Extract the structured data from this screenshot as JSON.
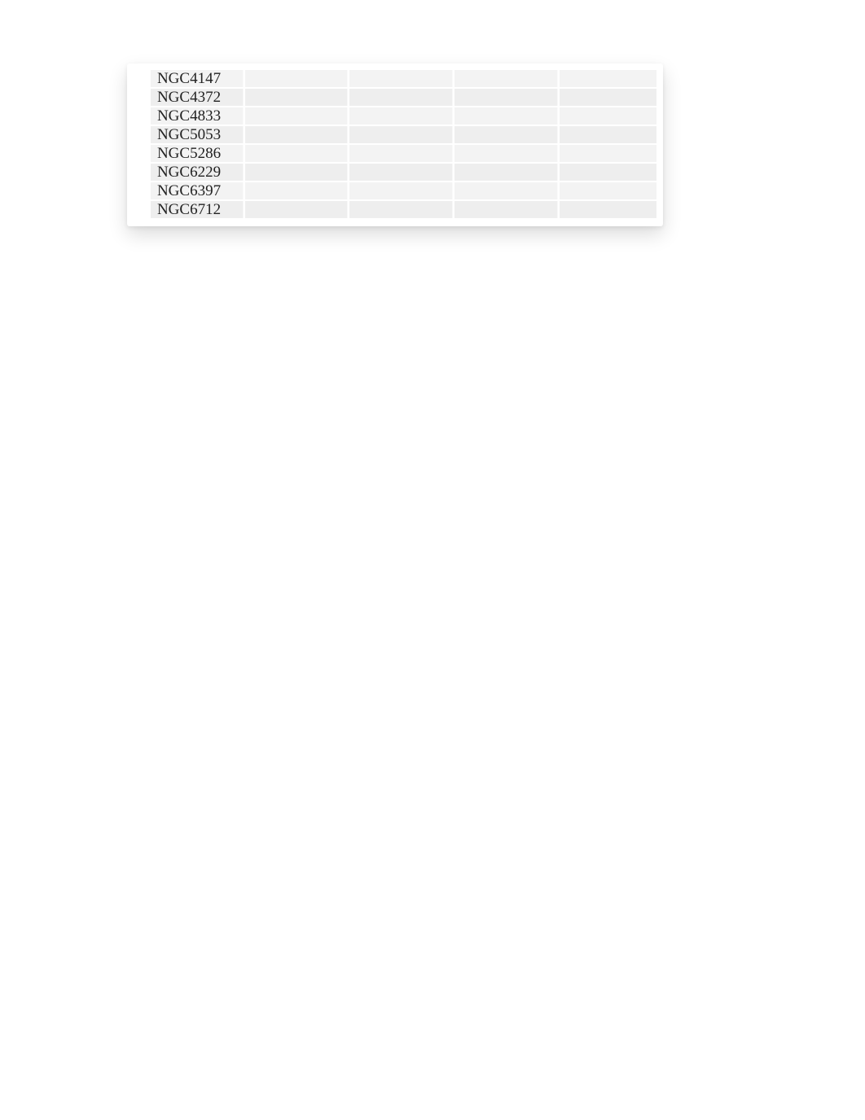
{
  "table": {
    "rows": [
      {
        "name": "NGC4147"
      },
      {
        "name": "NGC4372"
      },
      {
        "name": "NGC4833"
      },
      {
        "name": "NGC5053"
      },
      {
        "name": "NGC5286"
      },
      {
        "name": "NGC6229"
      },
      {
        "name": "NGC6397"
      },
      {
        "name": "NGC6712"
      }
    ]
  }
}
